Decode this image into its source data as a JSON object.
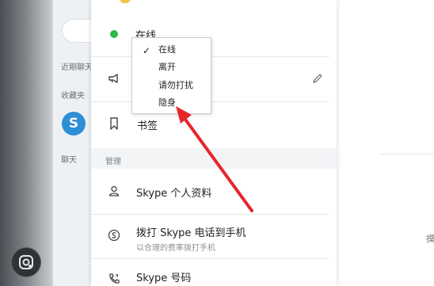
{
  "sidebar": {
    "recent_chats_label": "近期聊天",
    "favorites_label": "收藏夹",
    "chats_label": "聊天",
    "skype_logo_letter": "S"
  },
  "profile_menu": {
    "status_label": "在线",
    "bookmarks_label": "书签",
    "manage_section_label": "管理",
    "profile_label": "Skype 个人资料",
    "call_phones_label": "拨打 Skype 电话到手机",
    "call_phones_sub": "以合理的费率拨打手机",
    "skype_number_label": "Skype 号码"
  },
  "status_dropdown": {
    "items": [
      "在线",
      "离开",
      "请勿打扰",
      "隐身"
    ],
    "selected": "在线"
  },
  "content": {
    "edge_char": "摸"
  },
  "colors": {
    "online_green": "#2fb84a",
    "skype_blue": "#2d8fd6",
    "annotation_red": "#e5262b"
  },
  "icons": [
    "megaphone-icon",
    "pencil-icon",
    "bookmark-icon",
    "person-icon",
    "skype-coin-icon",
    "phone-icon",
    "lens-icon"
  ]
}
